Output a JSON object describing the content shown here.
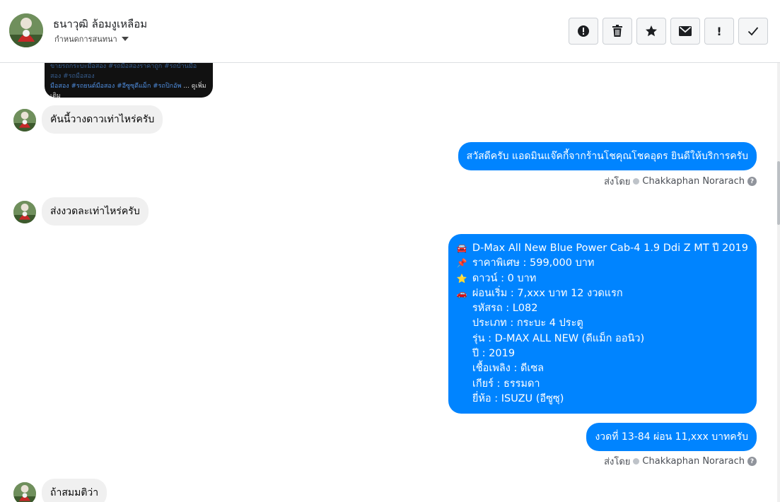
{
  "header": {
    "name": "ธนาวุฒิ ล้อมงูเหลือม",
    "subtitle": "กำหนดการสนทนา"
  },
  "toolbar": [
    {
      "icon": "alert-circle-icon"
    },
    {
      "icon": "trash-icon"
    },
    {
      "icon": "star-icon"
    },
    {
      "icon": "envelope-icon"
    },
    {
      "icon": "exclamation-icon",
      "glyph": "!"
    },
    {
      "icon": "checkmark-icon"
    }
  ],
  "preview": {
    "line1": "ขายรถกระบะมือสอง #รถมือสองราคาถูก #รถบ้านมือสอง #รถมือสอง",
    "line2": "มือสอง #รถยนต์มือสอง #อีซูซุดีแม็ก #รถปิกอัพ",
    "more": "... ดูเพิ่มเติม"
  },
  "messages": {
    "m1": "คันนี้วางดาวเท่าไหร่ครับ",
    "m2": "สวัสดีครับ แอดมินแจ๊คกี้จากร้านโชคุณโชคอุดร ยินดีให้บริการครับ",
    "m3": "ส่งงวดละเท่าไหร่ครับ",
    "m4": {
      "lines": [
        {
          "emoji": "🚘",
          "text": "D-Max All New Blue Power Cab-4 1.9 Ddi Z MT ปี 2019"
        },
        {
          "emoji": "📌",
          "text": "ราคาพิเศษ : 599,000 บาท"
        },
        {
          "emoji": "⭐",
          "text": "ดาวน์ : 0 บาท"
        },
        {
          "emoji": "🚗",
          "text": "ผ่อนเริ่ม : 7,xxx บาท 12 งวดแรก"
        },
        {
          "emoji": "",
          "text": "รหัสรถ : L082"
        },
        {
          "emoji": "",
          "text": "ประเภท : กระบะ 4 ประตู"
        },
        {
          "emoji": "",
          "text": "รุ่น : D-MAX ALL NEW (ดีแม็ก ออนิว)"
        },
        {
          "emoji": "",
          "text": "ปี : 2019"
        },
        {
          "emoji": "",
          "text": "เชื้อเพลิง : ดีเซล"
        },
        {
          "emoji": "",
          "text": "เกียร์ : ธรรมดา"
        },
        {
          "emoji": "",
          "text": "ยี่ห้อ : ISUZU (อีซูซุ)"
        }
      ]
    },
    "m5": "งวดที่ 13-84 ผ่อน 11,xxx บาทครับ",
    "m6": "ถ้าสมมติว่า"
  },
  "sent_by": {
    "label": "ส่งโดย",
    "name": "Chakkaphan Norarach",
    "help_glyph": "?"
  }
}
